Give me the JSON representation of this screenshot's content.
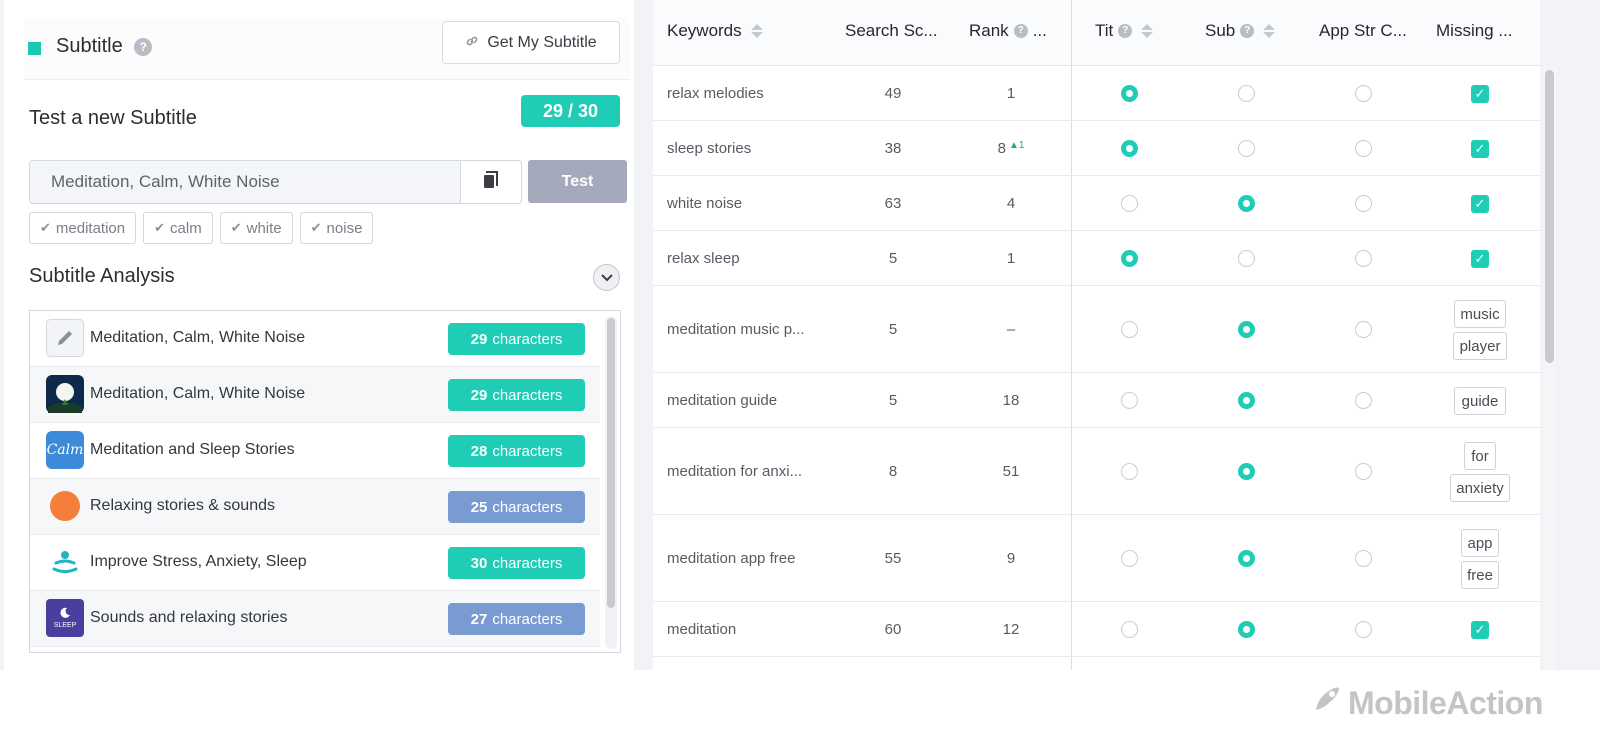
{
  "subtitle_panel": {
    "title": "Subtitle",
    "help": "?",
    "get_button": "Get My Subtitle",
    "test_title": "Test a new Subtitle",
    "counter": "29 / 30",
    "input_value": "Meditation, Calm, White Noise",
    "test_button": "Test",
    "tags": [
      "meditation",
      "calm",
      "white",
      "noise"
    ],
    "analysis_title": "Subtitle Analysis"
  },
  "analysis_rows": [
    {
      "icon": "pencil-icon",
      "text": "Meditation, Calm, White Noise",
      "count": "29",
      "unit": "characters",
      "badge_color": "#1fcdb6"
    },
    {
      "icon": "moon-app-icon",
      "text": "Meditation, Calm, White Noise",
      "count": "29",
      "unit": "characters",
      "badge_color": "#1fcdb6"
    },
    {
      "icon": "calm-app-icon",
      "app_label": "Calm",
      "text": "Meditation and Sleep Stories",
      "count": "28",
      "unit": "characters",
      "badge_color": "#1fcdb6"
    },
    {
      "icon": "orange-circle-icon",
      "text": "Relaxing stories & sounds",
      "count": "25",
      "unit": "characters",
      "badge_color": "#7a9bd1"
    },
    {
      "icon": "meditation-figure-icon",
      "text": "Improve Stress, Anxiety, Sleep",
      "count": "30",
      "unit": "characters",
      "badge_color": "#1fcdb6"
    },
    {
      "icon": "sleep-app-icon",
      "app_label": "SLEEP",
      "text": "Sounds and relaxing stories",
      "count": "27",
      "unit": "characters",
      "badge_color": "#7a9bd1"
    }
  ],
  "keywords_table": {
    "headers": {
      "keywords": "Keywords",
      "search_score": "Search Sc...",
      "rank": "Rank",
      "rank_ellipsis": "...",
      "title": "Tit",
      "subtitle": "Sub",
      "app_store": "App Str C...",
      "missing": "Missing ..."
    },
    "rows": [
      {
        "keyword": "relax melodies",
        "score": "49",
        "rank": "1",
        "rank_delta": "",
        "title": true,
        "subtitle": false,
        "app_store": false,
        "missing_check": true,
        "missing_tags": []
      },
      {
        "keyword": "sleep stories",
        "score": "38",
        "rank": "8",
        "rank_delta": "▲1",
        "title": true,
        "subtitle": false,
        "app_store": false,
        "missing_check": true,
        "missing_tags": []
      },
      {
        "keyword": "white noise",
        "score": "63",
        "rank": "4",
        "rank_delta": "",
        "title": false,
        "subtitle": true,
        "app_store": false,
        "missing_check": true,
        "missing_tags": []
      },
      {
        "keyword": "relax sleep",
        "score": "5",
        "rank": "1",
        "rank_delta": "",
        "title": true,
        "subtitle": false,
        "app_store": false,
        "missing_check": true,
        "missing_tags": []
      },
      {
        "keyword": "meditation music p...",
        "score": "5",
        "rank": "–",
        "rank_delta": "",
        "title": false,
        "subtitle": true,
        "app_store": false,
        "missing_check": false,
        "missing_tags": [
          "music",
          "player"
        ]
      },
      {
        "keyword": "meditation guide",
        "score": "5",
        "rank": "18",
        "rank_delta": "",
        "title": false,
        "subtitle": true,
        "app_store": false,
        "missing_check": false,
        "missing_tags": [
          "guide"
        ]
      },
      {
        "keyword": "meditation for anxi...",
        "score": "8",
        "rank": "51",
        "rank_delta": "",
        "title": false,
        "subtitle": true,
        "app_store": false,
        "missing_check": false,
        "missing_tags": [
          "for",
          "anxiety"
        ]
      },
      {
        "keyword": "meditation app free",
        "score": "55",
        "rank": "9",
        "rank_delta": "",
        "title": false,
        "subtitle": true,
        "app_store": false,
        "missing_check": false,
        "missing_tags": [
          "app",
          "free"
        ]
      },
      {
        "keyword": "meditation",
        "score": "60",
        "rank": "12",
        "rank_delta": "",
        "title": false,
        "subtitle": true,
        "app_store": false,
        "missing_check": true,
        "missing_tags": []
      }
    ]
  },
  "brand": {
    "name": "MobileAction",
    "accent": "#1fcdb6",
    "muted_badge": "#7a9bd1"
  }
}
